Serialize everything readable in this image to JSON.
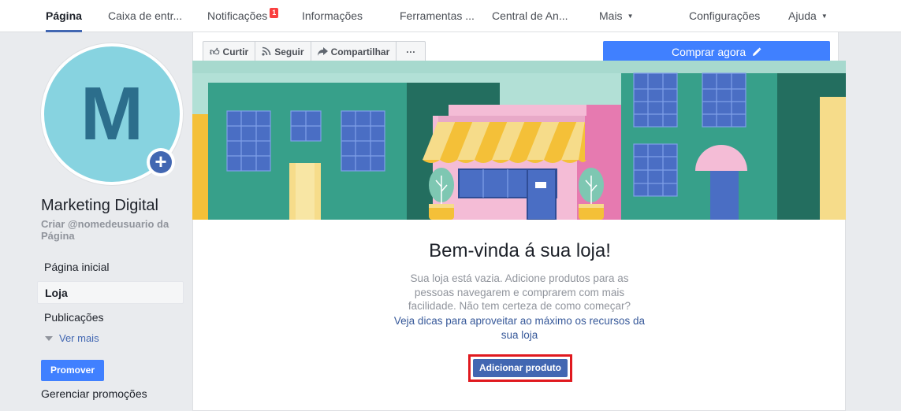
{
  "nav": {
    "items": [
      {
        "label": "Página",
        "active": true
      },
      {
        "label": "Caixa de entr..."
      },
      {
        "label": "Notificações",
        "badge": "1"
      },
      {
        "label": "Informações"
      },
      {
        "label": "Ferramentas ..."
      },
      {
        "label": "Central de An..."
      },
      {
        "label": "Mais"
      },
      {
        "label": "Configurações"
      },
      {
        "label": "Ajuda"
      }
    ]
  },
  "profile": {
    "avatar_letter": "M",
    "name": "Marketing Digital",
    "username_link": "Criar @nomedeusuario da Página"
  },
  "sidebar": {
    "items": [
      {
        "label": "Página inicial"
      },
      {
        "label": "Loja",
        "active": true
      },
      {
        "label": "Publicações"
      }
    ],
    "see_more": "Ver mais",
    "promote": "Promover",
    "manage": "Gerenciar promoções"
  },
  "actions": {
    "like": "Curtir",
    "follow": "Seguir",
    "share": "Compartilhar",
    "more": "···",
    "buy": "Comprar agora"
  },
  "shop": {
    "title": "Bem-vinda á sua loja!",
    "description": "Sua loja está vazia. Adicione produtos para as pessoas navegarem e comprarem com mais facilidade. Não tem certeza de como começar?",
    "tips_link": "Veja dicas para aproveitar ao máximo os recursos da sua loja",
    "add_button": "Adicionar produto"
  },
  "colors": {
    "brand_blue": "#4267b2",
    "button_blue": "#4080ff",
    "highlight_red": "#e0191f",
    "avatar_bg": "#87d3e0"
  }
}
